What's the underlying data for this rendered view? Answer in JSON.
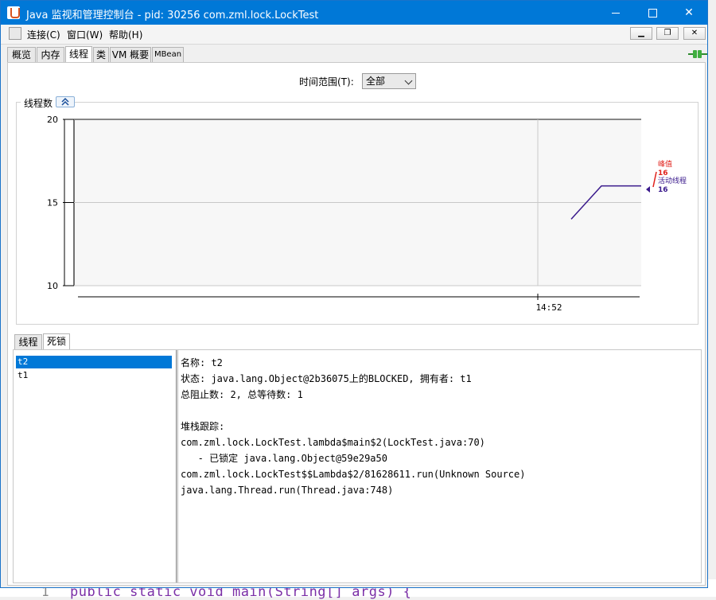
{
  "window": {
    "title": "Java 监视和管理控制台 - pid: 30256 com.zml.lock.LockTest",
    "icon": "java-app-icon"
  },
  "menubar": {
    "items": [
      "连接(C)",
      "窗口(W)",
      "帮助(H)"
    ],
    "inner_buttons": [
      "minimize",
      "restore",
      "close"
    ]
  },
  "tabs": [
    "概览",
    "内存",
    "线程",
    "类",
    "VM 概要",
    "MBean"
  ],
  "active_tab": "线程",
  "time_range": {
    "label": "时间范围(T):",
    "selected": "全部"
  },
  "chart_section": {
    "title": "线程数"
  },
  "chart_data": {
    "type": "line",
    "title": "线程数",
    "x_tick_labels": [
      "14:52"
    ],
    "ylim": [
      10,
      20
    ],
    "y_ticks": [
      10,
      15,
      20
    ],
    "grid": true,
    "series": [
      {
        "name": "峰值",
        "color": "#e0201a",
        "values": []
      },
      {
        "name": "活动线程",
        "color": "#3a1a8c",
        "points": [
          [
            0,
            14
          ],
          [
            1,
            16
          ],
          [
            2,
            16
          ]
        ]
      }
    ],
    "legend": {
      "position": "right",
      "items": [
        {
          "name": "峰值",
          "value": "16",
          "color": "#e0201a"
        },
        {
          "name": "活动线程",
          "value": "16",
          "color": "#3a1a8c"
        }
      ]
    }
  },
  "lower_tabs": [
    "线程",
    "死锁"
  ],
  "active_lower_tab": "死锁",
  "threads": [
    "t2",
    "t1"
  ],
  "selected_thread": "t2",
  "details": [
    "名称: t2",
    "状态: java.lang.Object@2b36075上的BLOCKED, 拥有者: t1",
    "总阻止数: 2, 总等待数: 1",
    "",
    "堆栈跟踪:",
    "com.zml.lock.LockTest.lambda$main$2(LockTest.java:70)",
    "   - 已锁定 java.lang.Object@59e29a50",
    "com.zml.lock.LockTest$$Lambda$2/81628611.run(Unknown Source)",
    "java.lang.Thread.run(Thread.java:748)"
  ],
  "underlay": {
    "line_number": "1",
    "code": "public static void main(String[] args) {"
  },
  "colors": {
    "titlebar": "#0078d7",
    "selection": "#0078d7",
    "peak": "#e0201a",
    "live": "#3a1a8c"
  }
}
